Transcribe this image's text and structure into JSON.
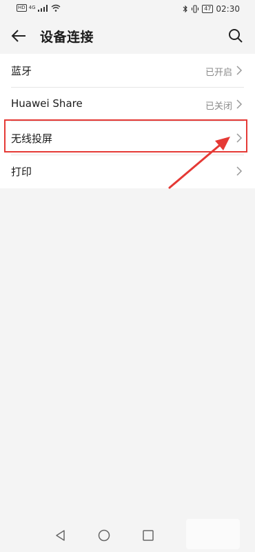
{
  "status_bar": {
    "hd_badge": "HD",
    "signal": "4G",
    "battery": "47",
    "time": "02:30"
  },
  "header": {
    "title": "设备连接"
  },
  "rows": [
    {
      "label": "蓝牙",
      "status": "已开启"
    },
    {
      "label": "Huawei Share",
      "status": "已关闭"
    },
    {
      "label": "无线投屏",
      "status": ""
    },
    {
      "label": "打印",
      "status": ""
    }
  ],
  "icons": {
    "back": "back-arrow-icon",
    "search": "search-icon",
    "chevron": "chevron-right-icon",
    "nav_back": "triangle-back-icon",
    "nav_home": "circle-home-icon",
    "nav_recent": "square-recent-icon"
  },
  "colors": {
    "highlight": "#e53935",
    "status_text": "#8a8a8a"
  }
}
